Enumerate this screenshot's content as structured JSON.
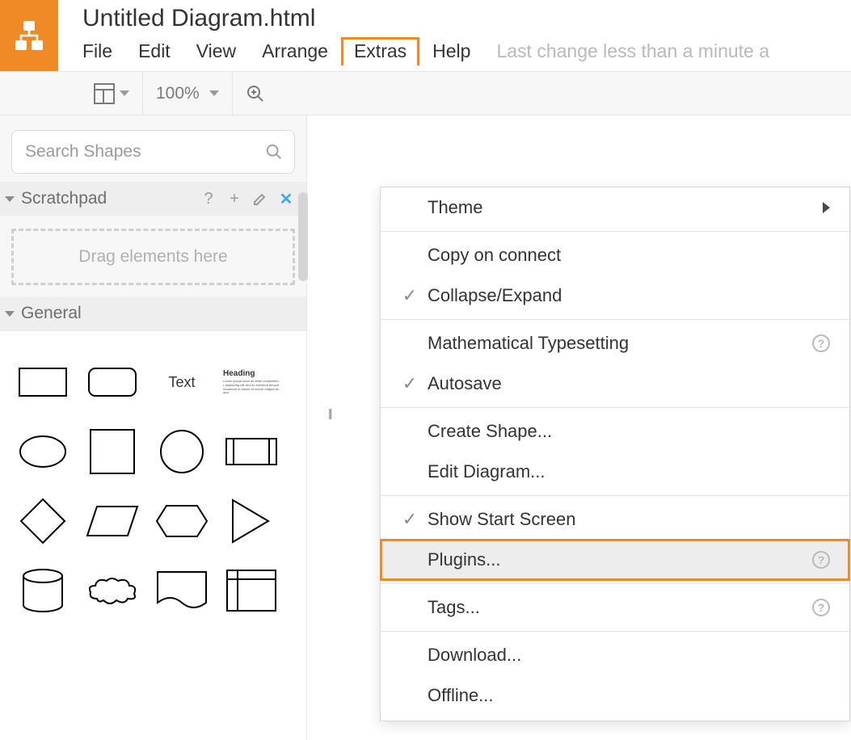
{
  "doc_title": "Untitled Diagram.html",
  "menubar": {
    "items": [
      "File",
      "Edit",
      "View",
      "Arrange",
      "Extras",
      "Help"
    ],
    "active_index": 4,
    "status_text": "Last change less than a minute a"
  },
  "toolbar": {
    "zoom_label": "100%"
  },
  "sidebar": {
    "search_placeholder": "Search Shapes",
    "scratchpad": {
      "title": "Scratchpad",
      "dropzone_text": "Drag elements here"
    },
    "general": {
      "title": "General",
      "text_label": "Text",
      "heading_label": "Heading"
    }
  },
  "dropdown": {
    "groups": [
      {
        "items": [
          {
            "label": "Theme",
            "checked": false,
            "submenu": true
          }
        ]
      },
      {
        "items": [
          {
            "label": "Copy on connect",
            "checked": false
          },
          {
            "label": "Collapse/Expand",
            "checked": true
          }
        ]
      },
      {
        "items": [
          {
            "label": "Mathematical Typesetting",
            "checked": false,
            "help": true
          },
          {
            "label": "Autosave",
            "checked": true
          }
        ]
      },
      {
        "items": [
          {
            "label": "Create Shape...",
            "checked": false
          },
          {
            "label": "Edit Diagram...",
            "checked": false
          }
        ]
      },
      {
        "items": [
          {
            "label": "Show Start Screen",
            "checked": true
          },
          {
            "label": "Plugins...",
            "checked": false,
            "help": true,
            "highlight": true
          }
        ]
      },
      {
        "items": [
          {
            "label": "Tags...",
            "checked": false,
            "help": true
          }
        ]
      },
      {
        "items": [
          {
            "label": "Download...",
            "checked": false
          },
          {
            "label": "Offline...",
            "checked": false
          }
        ]
      }
    ]
  },
  "colors": {
    "brand": "#f08a24"
  }
}
